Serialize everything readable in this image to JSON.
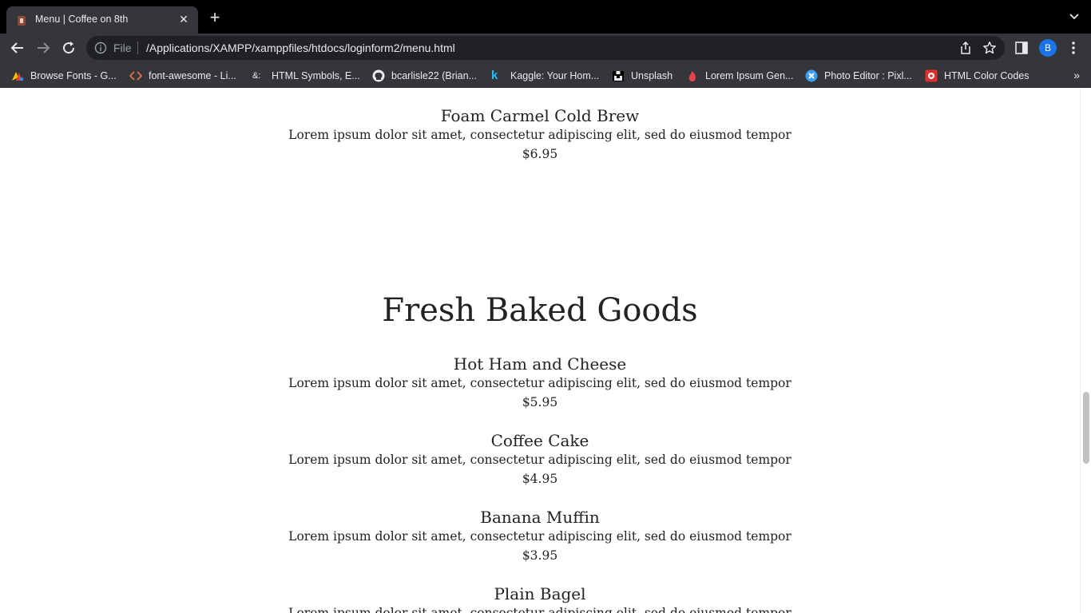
{
  "browser": {
    "tab": {
      "title": "Menu | Coffee on 8th"
    },
    "omnibox": {
      "scheme_label": "File",
      "url": "/Applications/XAMPP/xamppfiles/htdocs/loginform2/menu.html"
    },
    "profile_initial": "B",
    "bookmarks": [
      {
        "label": "Browse Fonts - G...",
        "icon": "google-fonts-icon"
      },
      {
        "label": "font-awesome - Li...",
        "icon": "code-brackets-icon"
      },
      {
        "label": "HTML Symbols, E...",
        "icon": "ampersand-icon"
      },
      {
        "label": "bcarlisle22 (Brian...",
        "icon": "github-icon"
      },
      {
        "label": "Kaggle: Your Hom...",
        "icon": "kaggle-icon"
      },
      {
        "label": "Unsplash",
        "icon": "unsplash-icon"
      },
      {
        "label": "Lorem Ipsum Gen...",
        "icon": "lorem-ipsum-icon"
      },
      {
        "label": "Photo Editor : Pixl...",
        "icon": "pixlr-icon"
      },
      {
        "label": "HTML Color Codes",
        "icon": "color-codes-icon"
      }
    ]
  },
  "page": {
    "top_item": {
      "name": "Foam Carmel Cold Brew",
      "desc": "Lorem ipsum dolor sit amet, consectetur adipiscing elit, sed do eiusmod tempor",
      "price": "$6.95"
    },
    "section": {
      "title": "Fresh Baked Goods",
      "items": [
        {
          "name": "Hot Ham and Cheese",
          "desc": "Lorem ipsum dolor sit amet, consectetur adipiscing elit, sed do eiusmod tempor",
          "price": "$5.95"
        },
        {
          "name": "Coffee Cake",
          "desc": "Lorem ipsum dolor sit amet, consectetur adipiscing elit, sed do eiusmod tempor",
          "price": "$4.95"
        },
        {
          "name": "Banana Muffin",
          "desc": "Lorem ipsum dolor sit amet, consectetur adipiscing elit, sed do eiusmod tempor",
          "price": "$3.95"
        },
        {
          "name": "Plain Bagel",
          "desc": "Lorem ipsum dolor sit amet, consectetur adipiscing elit, sed do eiusmod tempor",
          "price": ""
        }
      ]
    }
  }
}
